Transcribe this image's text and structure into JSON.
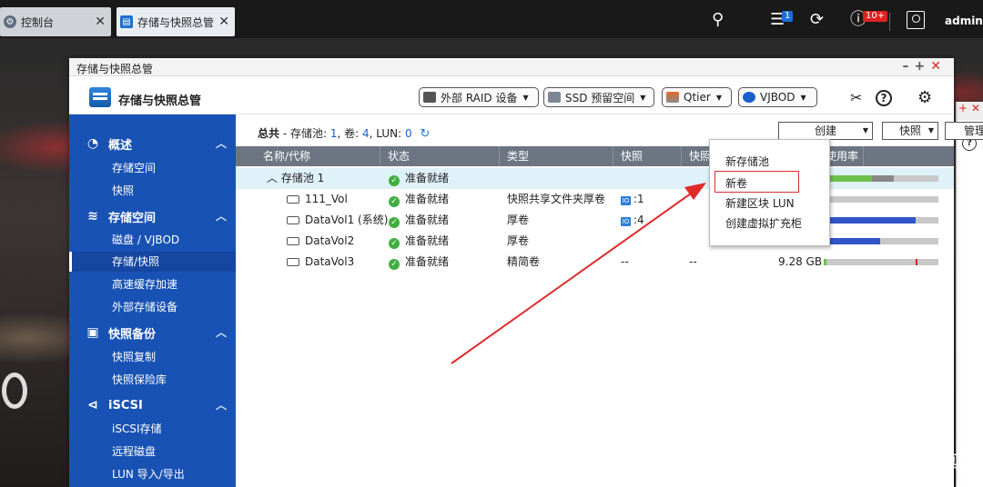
{
  "taskbar": {
    "tabs": [
      {
        "label": "控制台",
        "icon": "gear-icon"
      },
      {
        "label": "存储与快照总管",
        "icon": "storage-app-icon"
      }
    ],
    "notification_badge": "1",
    "info_badge": "10+",
    "user": "admin"
  },
  "window": {
    "title": "存储与快照总管",
    "app_title": "存储与快照总管",
    "toolbar": {
      "raid_label": "外部 RAID 设备",
      "ssd_label": "SSD 预留空间",
      "qtier_label": "Qtier",
      "vjbod_label": "VJBOD"
    }
  },
  "sidebar": {
    "sections": [
      {
        "label": "概述",
        "icon": "dashboard-icon",
        "items": [
          "存储空间",
          "快照"
        ]
      },
      {
        "label": "存储空间",
        "icon": "database-icon",
        "items": [
          "磁盘 / VJBOD",
          "存储/快照",
          "高速缓存加速",
          "外部存储设备"
        ]
      },
      {
        "label": "快照备份",
        "icon": "snapshot-icon",
        "items": [
          "快照复制",
          "快照保险库"
        ]
      },
      {
        "label": "iSCSI",
        "icon": "share-icon",
        "items": [
          "iSCSI存储",
          "远程磁盘",
          "LUN 导入/导出"
        ]
      }
    ],
    "active_item": "存储/快照"
  },
  "summary": {
    "label": "总共",
    "pool_text": "存储池: ",
    "pool_count": "1",
    "vol_text": ", 卷: ",
    "vol_count": "4",
    "lun_text": ", LUN: ",
    "lun_count": "0"
  },
  "actions": {
    "create": "创建",
    "snapshot": "快照",
    "manage": "管理"
  },
  "table": {
    "columns": [
      "名称/代称",
      "状态",
      "类型",
      "快照",
      "快照",
      "使用率"
    ],
    "rows": [
      {
        "name": "存储池 1",
        "status": "准备就绪",
        "type": "",
        "snapshot": "",
        "snap2": "",
        "size": "",
        "usage": 0.77,
        "kind": "pool"
      },
      {
        "name": "111_Vol",
        "status": "准备就绪",
        "type": "快照共享文件夹厚卷",
        "snapshot": ":1",
        "snap2": "",
        "size": "",
        "usage": 0.0,
        "kind": "volume"
      },
      {
        "name": "DataVol1 (系统)",
        "status": "准备就绪",
        "type": "厚卷",
        "snapshot": ":4",
        "snap2": "",
        "size": "",
        "usage": 0.8,
        "kind": "volume"
      },
      {
        "name": "DataVol2",
        "status": "准备就绪",
        "type": "厚卷",
        "snapshot": "",
        "snap2": "",
        "size": "",
        "usage": 0.49,
        "kind": "volume"
      },
      {
        "name": "DataVol3",
        "status": "准备就绪",
        "type": "精简卷",
        "snapshot": "--",
        "snap2": "--",
        "size": "9.28 GB",
        "usage": 0.82,
        "kind": "volume"
      }
    ]
  },
  "create_menu": {
    "items": [
      "新存储池",
      "新卷",
      "新建区块 LUN",
      "创建虚拟扩充柜"
    ],
    "highlighted": "新卷"
  },
  "watermark": "什么值得买",
  "colors": {
    "sidebar": "#1852b4",
    "accent": "#1a5fd0",
    "ok": "#3fae3f",
    "usage_blue": "#2f55c8",
    "usage_green": "#6cc04a",
    "annotation": "#d83030"
  }
}
